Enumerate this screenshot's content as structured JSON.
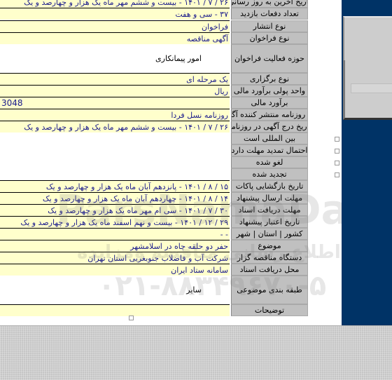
{
  "colors": {
    "label_bg": "#c0c0c0",
    "value_bg": "#ffffcc",
    "value_text": "#1a1a8c",
    "side_panel": "#003366"
  },
  "rows": [
    {
      "label": "تاریخ آخرین به روز رسانی",
      "value": "۲۶ / ۷ / ۱۴۰۱ - بیست و ششم مهر ماه یک هزار و چهارصد و یک",
      "style": "yellow"
    },
    {
      "label": "تعداد دفعات بازدید",
      "value": "۳۷ - سی و هفت",
      "style": "yellow"
    },
    {
      "label": "نوع انتشار",
      "value": "فراخوان",
      "style": "yellow"
    },
    {
      "label": "نوع فراخوان",
      "value": "آگهی مناقصه",
      "style": "yellow"
    },
    {
      "label": "حوزه فعالیت فراخوان",
      "value": "امور پیمانکاری",
      "style": "plain"
    },
    {
      "label": "نوع برگزاری",
      "value": "یک مرحله ای",
      "style": "yellow"
    },
    {
      "label": "واحد پولی برآورد مالی",
      "value": "ریال",
      "style": "yellow"
    },
    {
      "label": "برآورد مالی",
      "value": "3048",
      "style": "ltr"
    },
    {
      "label": "نام روزنامه منتشر کننده آگهی",
      "value": "روزنامه نسل فردا",
      "style": "yellow"
    },
    {
      "label": "تاریخ درج آگهی در روزنامه",
      "value": "۲۶ / ۷ / ۱۴۰۱ - بیست و ششم مهر ماه یک هزار و چهارصد و یک",
      "style": "yellow"
    },
    {
      "label": "بین المللی است",
      "value": "",
      "style": "check"
    },
    {
      "label": "احتمال تمدید مهلت دارد",
      "value": "",
      "style": "check"
    },
    {
      "label": "لغو شده",
      "value": "",
      "style": "check"
    },
    {
      "label": "تجدید شده",
      "value": "",
      "style": "check"
    },
    {
      "label": "تاریخ بازگشایی پاکات",
      "value": "۱۵ / ۸ / ۱۴۰۱ - پانزدهم آبان ماه یک هزار و چهارصد و یک",
      "style": "yellow"
    },
    {
      "label": "مهلت ارسال پیشنهاد",
      "value": "۱۴ / ۸ / ۱۴۰۱ - چهاردهم آبان ماه یک هزار و چهارصد و یک",
      "style": "yellow"
    },
    {
      "label": "مهلت دریافت اسناد",
      "value": "۳۰ / ۷ / ۱۴۰۱ - سی ام مهر ماه یک هزار و چهارصد و یک",
      "style": "yellow"
    },
    {
      "label": "تاریخ اعتبار پیشنهاد",
      "value": "۲۹ / ۱۲ / ۱۴۰۱ - بیست و نهم اسفند ماه یک هزار و چهارصد و یک",
      "style": "yellow"
    },
    {
      "label": "کشور | استان | شهر",
      "value": "- -",
      "style": "yellow"
    },
    {
      "label": "موضوع",
      "value": "حفر دو حلقه چاه در اسلامشهر",
      "style": "yellow"
    },
    {
      "label": "دستگاه مناقصه گزار",
      "value": "شرکت آب و فاضلاب جنوبغربی استان تهران",
      "style": "yellow"
    },
    {
      "label": "محل دریافت اسناد",
      "value": "سامانه ستاد ایران",
      "style": "yellow"
    },
    {
      "label": "طبقه بندی موضوعی",
      "value": "سایر",
      "style": "plain"
    },
    {
      "label": "توضیحات",
      "value": "",
      "style": "yellow"
    }
  ],
  "watermark": {
    "brand": "ParsNamaData",
    "phone": "۰۲۱-۸۸۳۴۹۶۷۰-۵",
    "tagline": "سامانه اطلاع رسانی مناقصه ومزایده"
  }
}
